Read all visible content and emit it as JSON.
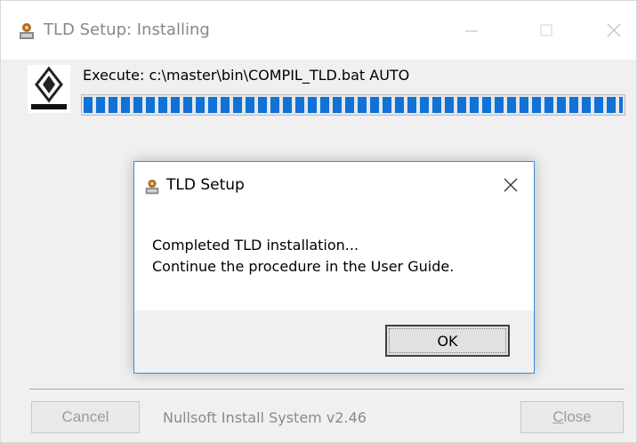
{
  "window": {
    "title": "TLD Setup: Installing",
    "title_icon": "setup-icon"
  },
  "header": {
    "logo_icon": "renault-logo-icon",
    "execute_text": "Execute: c:\\master\\bin\\COMPIL_TLD.bat AUTO",
    "progress_percent": 100
  },
  "footer": {
    "cancel_label": "Cancel",
    "branding": "Nullsoft Install System v2.46",
    "close_label_first": "C",
    "close_label_rest": "lose"
  },
  "dialog": {
    "title": "TLD Setup",
    "message_line1": "Completed TLD installation...",
    "message_line2": "Continue the procedure in the User Guide.",
    "ok_label": "OK"
  },
  "colors": {
    "progress": "#0f72d8",
    "dialog_border": "#3b8ed8"
  }
}
